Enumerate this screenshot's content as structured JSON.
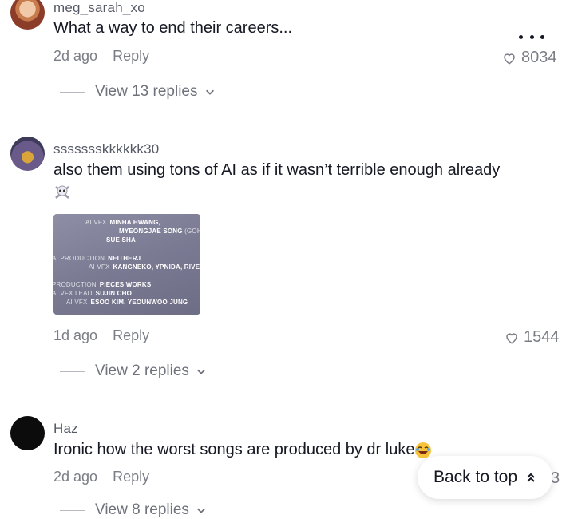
{
  "comments": [
    {
      "username": "meg_sarah_xo",
      "text": "What a way to end their careers...",
      "time": "2d ago",
      "reply_label": "Reply",
      "likes": "8034",
      "view_replies": "View 13 replies"
    },
    {
      "username": "ssssssskkkkkk30",
      "text": "also them using tons of AI as if it wasn’t terrible enough already",
      "emoji": "skull-crossbones",
      "time": "1d ago",
      "reply_label": "Reply",
      "likes": "1544",
      "view_replies": "View 2 replies",
      "image_credits": [
        {
          "role": "AI VFX",
          "names": "MINHA HWANG,"
        },
        {
          "role": "",
          "names": "MYEONGJAE SONG"
        },
        {
          "role": "",
          "names": "(GOHGO"
        },
        {
          "role": "",
          "names": "SUE SHA"
        },
        {
          "role": "AI PRODUCTION",
          "names": "NEITHERJ"
        },
        {
          "role": "AI VFX",
          "names": "KANGNEKO, YPNIDA, RIVER I"
        },
        {
          "role": "PRODUCTION",
          "names": "PIECES WORKS"
        },
        {
          "role": "AI VFX LEAD",
          "names": "SUJIN CHO"
        },
        {
          "role": "AI VFX",
          "names": "ESOO KIM, YEOUNWOO JUNG"
        }
      ]
    },
    {
      "username": "Haz",
      "text": "Ironic how the worst songs are produced by dr luke",
      "emoji": "laughing-face",
      "time": "2d ago",
      "reply_label": "Reply",
      "likes_partial": "3",
      "view_replies": "View 8 replies"
    }
  ],
  "back_to_top": "Back to top",
  "colors": {
    "text": "#161823",
    "muted": "#7a7d85",
    "background": "#ffffff"
  }
}
